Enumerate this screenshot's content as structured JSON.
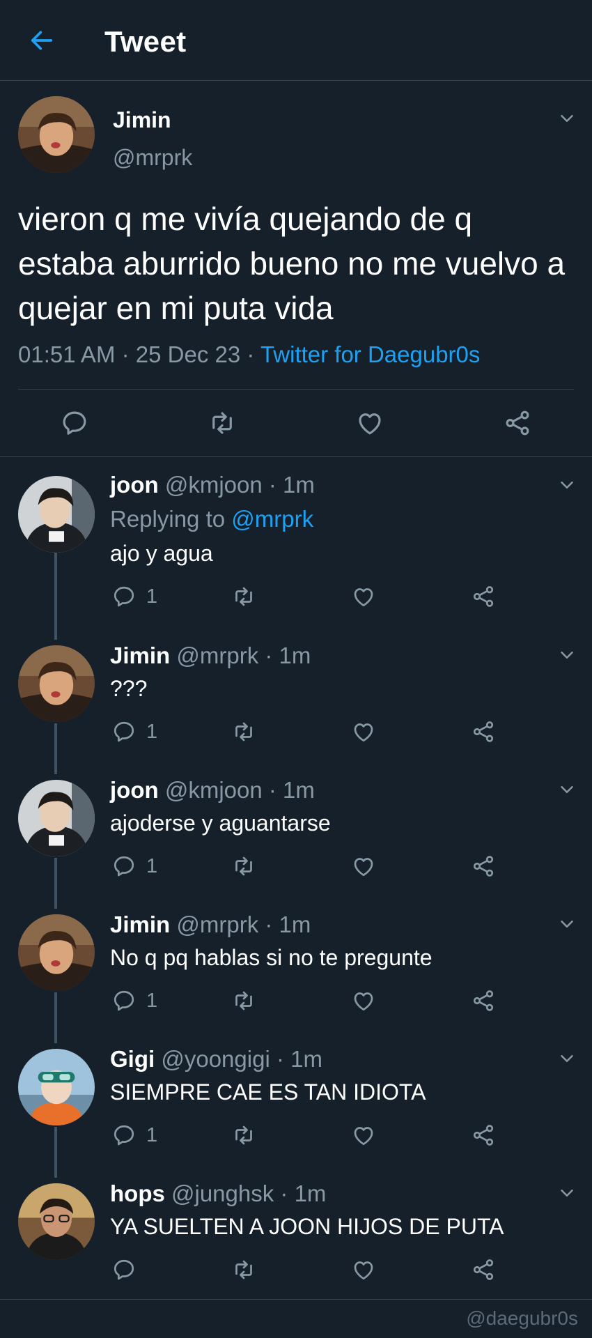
{
  "header": {
    "title": "Tweet",
    "back_icon": "arrow-left-icon"
  },
  "colors": {
    "background": "#15202b",
    "accent": "#1da1f2",
    "muted": "#8899a6",
    "border": "#38444d"
  },
  "main_tweet": {
    "name": "Jimin",
    "handle": "@mrprk",
    "text": "vieron q me vivía quejando de q estaba aburrido bueno no me vuelvo a quejar en mi puta vida",
    "time": "01:51 AM",
    "date": "25 Dec 23",
    "sep1": " · ",
    "sep2": " · ",
    "source": "Twitter for Daegubr0s"
  },
  "replies": [
    {
      "name": "joon",
      "handle": "@kmjoon",
      "sep": " · ",
      "time": "1m",
      "replying_label": "Replying to ",
      "replying_to": "@mrprk",
      "text": "ajo y agua",
      "reply_count": "1"
    },
    {
      "name": "Jimin",
      "handle": "@mrprk",
      "sep": " · ",
      "time": "1m",
      "text": "???",
      "reply_count": "1"
    },
    {
      "name": "joon",
      "handle": "@kmjoon",
      "sep": " · ",
      "time": "1m",
      "text": "ajoderse y aguantarse",
      "reply_count": "1"
    },
    {
      "name": "Jimin",
      "handle": "@mrprk",
      "sep": " · ",
      "time": "1m",
      "text": "No q pq hablas si no te pregunte",
      "reply_count": "1"
    },
    {
      "name": "Gigi",
      "handle": "@yoongigi",
      "sep": " · ",
      "time": "1m",
      "text": "SIEMPRE CAE ES TAN IDIOTA",
      "reply_count": "1"
    },
    {
      "name": "hops",
      "handle": "@junghsk",
      "sep": " · ",
      "time": "1m",
      "text": "YA SUELTEN A JOON HIJOS DE PUTA",
      "reply_count": ""
    }
  ],
  "watermark": "@daegubr0s"
}
